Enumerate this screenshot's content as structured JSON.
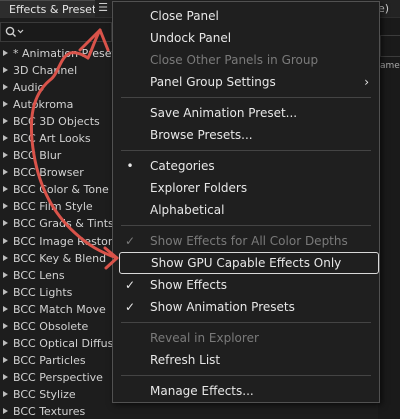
{
  "panel": {
    "tab_title": "Effects & Presets",
    "menu_icon": "hamburger-menu-icon",
    "right_tab_text": "e)",
    "right_side_label": "ame"
  },
  "search": {
    "icon": "search-icon",
    "value": ""
  },
  "effects_list": [
    "* Animation Presets",
    "3D Channel",
    "Audio",
    "Autokroma",
    "BCC 3D Objects",
    "BCC Art Looks",
    "BCC Blur",
    "BCC Browser",
    "BCC Color & Tone",
    "BCC Film Style",
    "BCC Grads & Tints",
    "BCC Image Restoration",
    "BCC Key & Blend",
    "BCC Lens",
    "BCC Lights",
    "BCC Match Move",
    "BCC Obsolete",
    "BCC Optical Diffusion",
    "BCC Particles",
    "BCC Perspective",
    "BCC Stylize",
    "BCC Textures"
  ],
  "context_menu": {
    "items": [
      {
        "label": "Close Panel"
      },
      {
        "label": "Undock Panel"
      },
      {
        "label": "Close Other Panels in Group",
        "disabled": true
      },
      {
        "label": "Panel Group Settings",
        "submenu": true
      },
      {
        "separator": true
      },
      {
        "label": "Save Animation Preset..."
      },
      {
        "label": "Browse Presets..."
      },
      {
        "separator": true
      },
      {
        "label": "Categories",
        "mark": "bullet"
      },
      {
        "label": "Explorer Folders"
      },
      {
        "label": "Alphabetical"
      },
      {
        "separator": true
      },
      {
        "label": "Show Effects for All Color Depths",
        "disabled": true,
        "mark": "check"
      },
      {
        "label": "Show GPU Capable Effects Only",
        "highlighted": true
      },
      {
        "label": "Show Effects",
        "mark": "check"
      },
      {
        "label": "Show Animation Presets",
        "mark": "check"
      },
      {
        "separator": true
      },
      {
        "label": "Reveal in Explorer",
        "disabled": true
      },
      {
        "label": "Refresh List"
      },
      {
        "separator": true
      },
      {
        "label": "Manage Effects..."
      }
    ],
    "glyphs": {
      "check": "✓",
      "bullet": "•",
      "submenu": "›"
    }
  },
  "colors": {
    "background": "#1d1d1d",
    "menu_background": "#1f1f1f",
    "text": "#e8e8e8",
    "disabled_text": "#7a7a7a",
    "highlight_border": "#d9d9d9",
    "annotation_arrow": "#d9534a"
  }
}
